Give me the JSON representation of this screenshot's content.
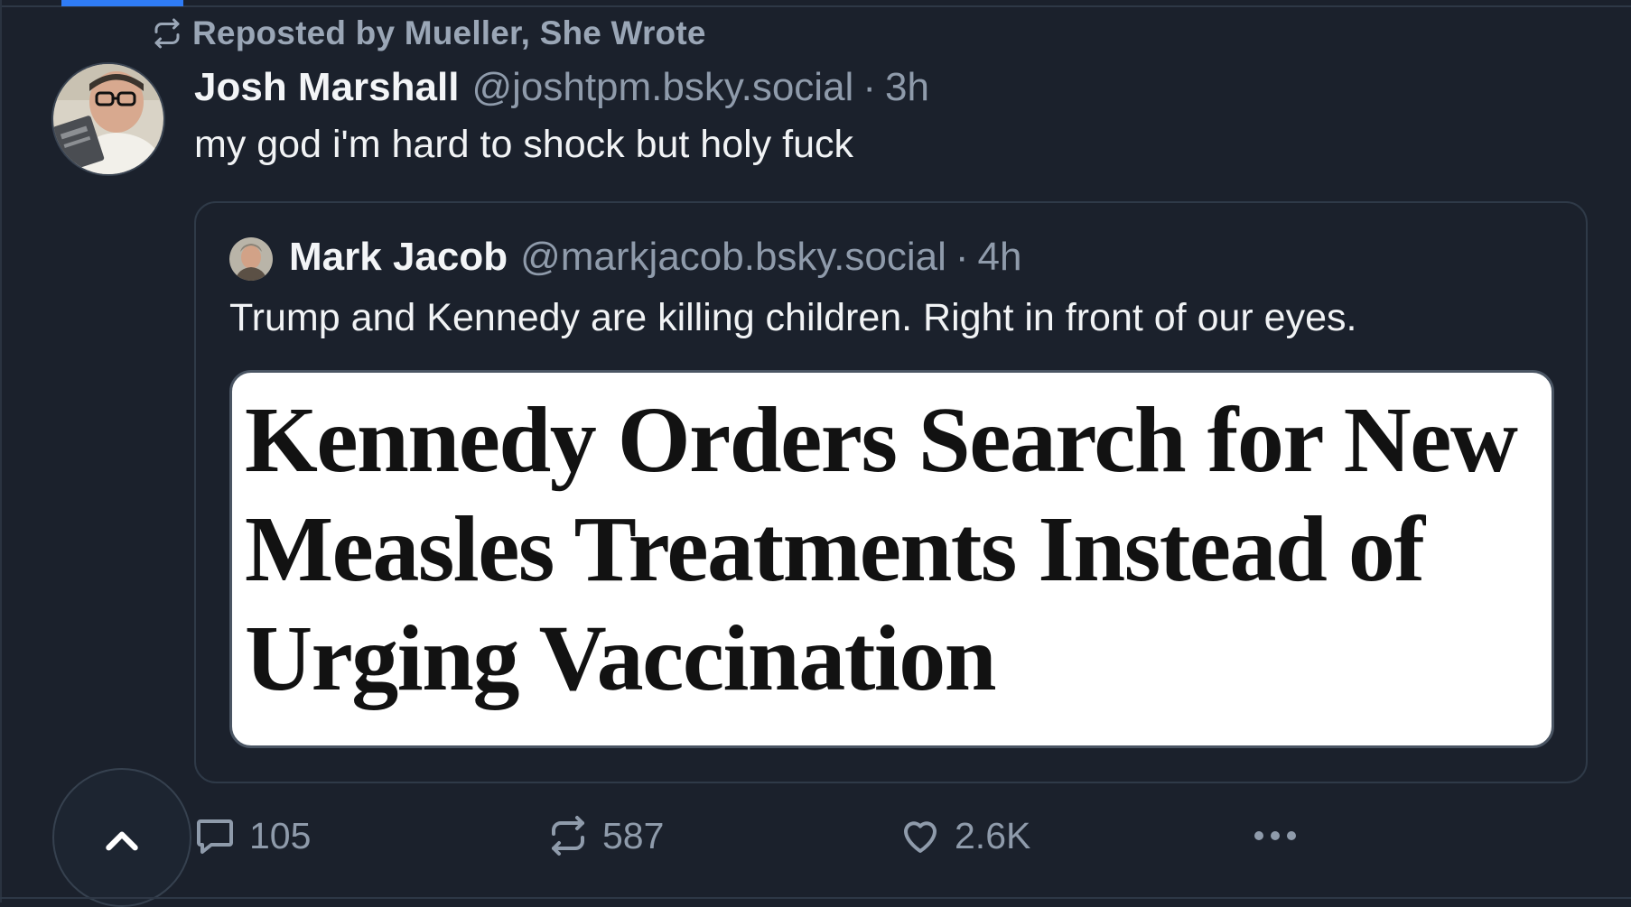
{
  "repost": {
    "label": "Reposted by Mueller, She Wrote"
  },
  "post": {
    "author_name": "Josh Marshall",
    "author_handle": "@joshtpm.bsky.social",
    "separator": "·",
    "time": "3h",
    "text": "my god i'm hard to shock but holy fuck"
  },
  "quote": {
    "author_name": "Mark Jacob",
    "author_handle": "@markjacob.bsky.social",
    "separator": "·",
    "time": "4h",
    "text": "Trump and Kennedy are killing children. Right in front of our eyes.",
    "image_headline": "Kennedy Orders Search for New Measles Treatments Instead of Urging Vaccination"
  },
  "actions": {
    "reply_count": "105",
    "repost_count": "587",
    "like_count": "2.6K"
  },
  "icons": {
    "repost": "repost-icon",
    "reply": "speech-bubble-icon",
    "like": "heart-icon",
    "more": "ellipsis-icon",
    "scroll_top": "chevron-up-icon"
  },
  "colors": {
    "background": "#1b212c",
    "accent": "#2f7cf6",
    "muted_text": "#8f9bab",
    "primary_text": "#f1f3f5"
  }
}
